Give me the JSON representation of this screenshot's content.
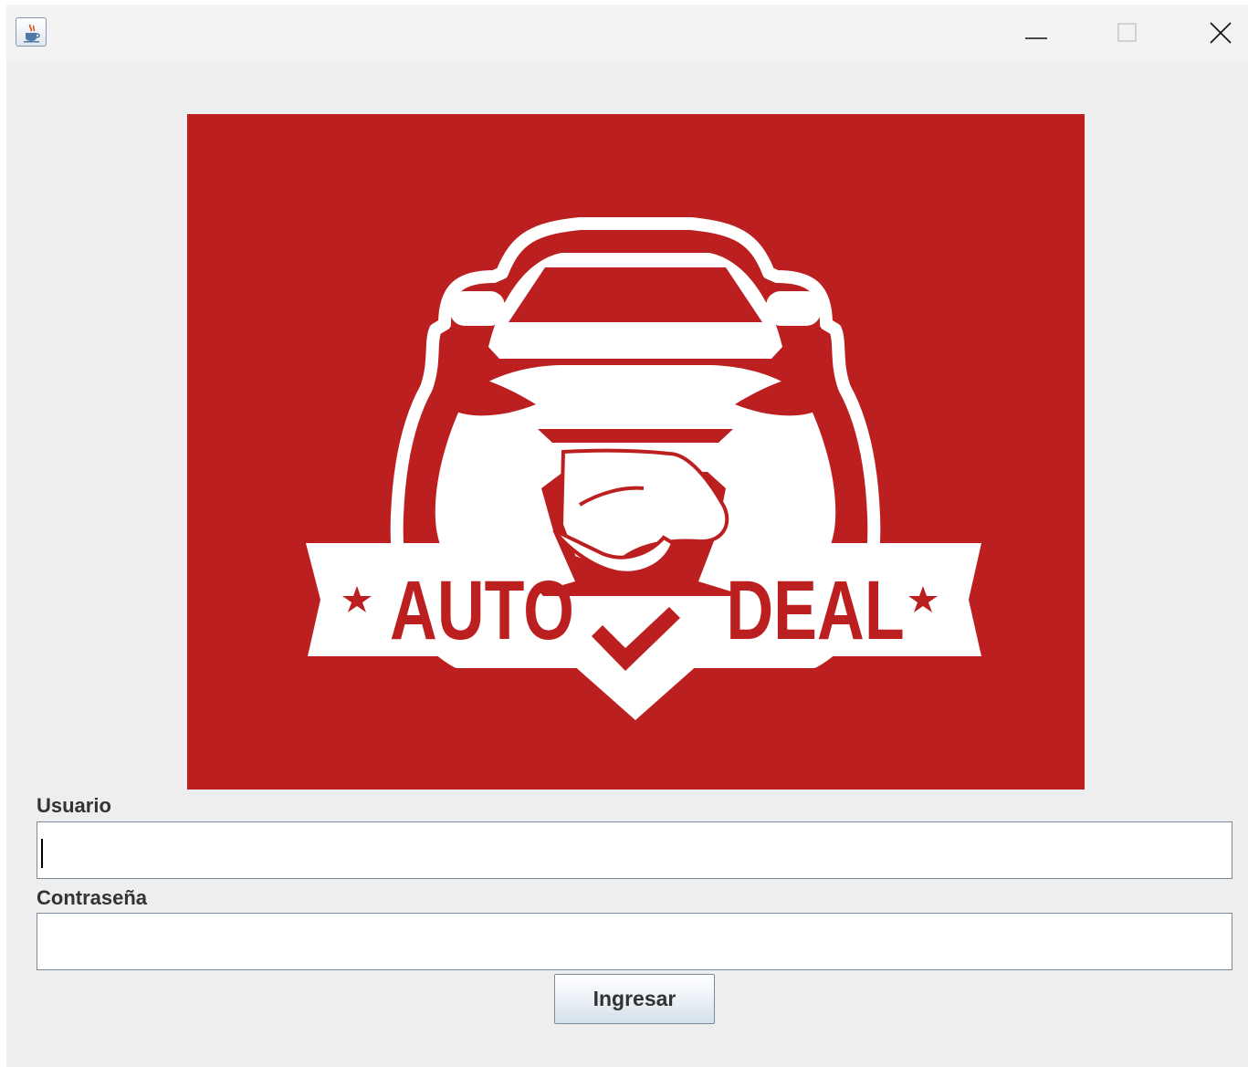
{
  "window": {
    "icon": "java-cup-icon",
    "controls": [
      "minimize-icon",
      "maximize-icon",
      "close-icon"
    ]
  },
  "logo": {
    "word_left": "AUTO",
    "word_right": "DEAL",
    "background_color": "#BC1F1F",
    "foreground_color": "#FFFFFF"
  },
  "form": {
    "username_label": "Usuario",
    "username_value": "",
    "password_label": "Contraseña",
    "password_value": "",
    "submit_label": "Ingresar"
  }
}
